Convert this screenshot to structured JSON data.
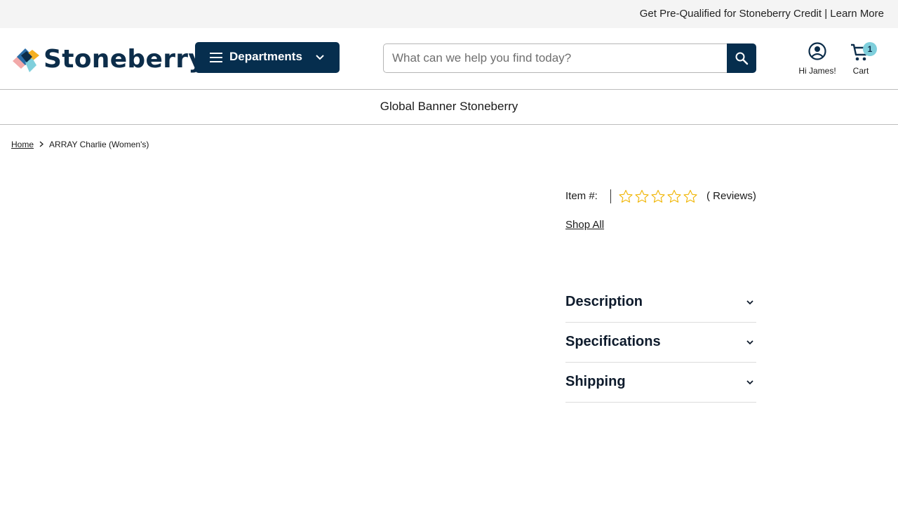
{
  "topbar": {
    "promo_text": "Get Pre-Qualified for Stoneberry Credit",
    "separator": " | ",
    "learn_more": "Learn More"
  },
  "header": {
    "logo_text": "Stoneberry",
    "departments_label": "Departments",
    "search_placeholder": "What can we help you find today?",
    "search_value": "",
    "account_label": "Hi James!",
    "cart_label": "Cart",
    "cart_count": "1"
  },
  "banner": {
    "text": "Global Banner Stoneberry"
  },
  "breadcrumb": {
    "home": "Home",
    "current": "ARRAY Charlie (Women's)"
  },
  "product": {
    "item_label": "Item #:",
    "rating": 0,
    "max_rating": 5,
    "reviews_text": "( Reviews)",
    "shop_all": "Shop All"
  },
  "accordion": [
    {
      "title": "Description"
    },
    {
      "title": "Specifications"
    },
    {
      "title": "Shipping"
    }
  ],
  "colors": {
    "brand_navy": "#062e4e",
    "badge": "#7fcfdc",
    "star_outline": "#f0b400"
  },
  "icons": {
    "menu": "hamburger-icon",
    "dropdown": "chevron-down-icon",
    "search": "search-icon",
    "account": "account-circle-icon",
    "cart": "cart-icon",
    "breadcrumb_sep": "chevron-right-icon",
    "rating": "star-outline-icon"
  }
}
